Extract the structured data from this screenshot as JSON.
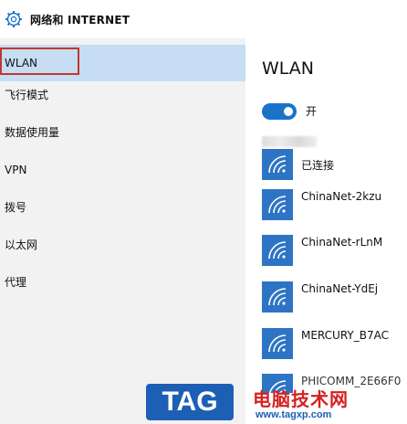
{
  "header": {
    "title": "网络和 INTERNET",
    "icon": "gear-icon"
  },
  "sidebar": {
    "items": [
      {
        "label": "WLAN",
        "active": true
      },
      {
        "label": "飞行模式",
        "active": false
      },
      {
        "label": "数据使用量",
        "active": false
      },
      {
        "label": "VPN",
        "active": false
      },
      {
        "label": "拨号",
        "active": false
      },
      {
        "label": "以太网",
        "active": false
      },
      {
        "label": "代理",
        "active": false
      }
    ]
  },
  "content": {
    "title": "WLAN",
    "toggle": {
      "label": "开",
      "on": true
    },
    "networks": [
      {
        "name": "已连接"
      },
      {
        "name": "ChinaNet-2kzu"
      },
      {
        "name": "ChinaNet-rLnM"
      },
      {
        "name": "ChinaNet-YdEj"
      },
      {
        "name": "MERCURY_B7AC"
      },
      {
        "name": "PHICOMM_2E66F0"
      }
    ]
  },
  "watermark": {
    "logo": "TAG",
    "title": "电脑技术网",
    "url": "www.tagxp.com"
  },
  "colors": {
    "accent": "#1a73c9",
    "active_bg": "#c6ddf3",
    "highlight": "#c0392b",
    "wifi_tile": "#2d74c4"
  }
}
